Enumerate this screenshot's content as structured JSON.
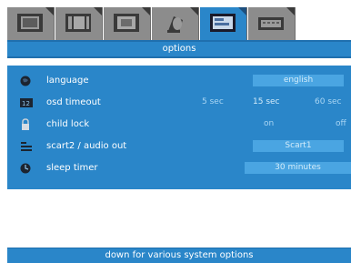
{
  "tabs": [
    {
      "icon": "tv-screen-icon",
      "active": false
    },
    {
      "icon": "picture-frame-icon",
      "active": false
    },
    {
      "icon": "monitor-icon",
      "active": false
    },
    {
      "icon": "speaker-icon",
      "active": false
    },
    {
      "icon": "settings-screen-icon",
      "active": true
    },
    {
      "icon": "keyboard-input-icon",
      "active": false
    }
  ],
  "header": {
    "title": "options"
  },
  "menu": {
    "language": {
      "label": "language",
      "value": "english",
      "icon": "globe-icon"
    },
    "osd_timeout": {
      "label": "osd timeout",
      "icon": "timer-display-icon",
      "options": [
        "5 sec",
        "15 sec",
        "60 sec"
      ],
      "selected": "15 sec"
    },
    "child_lock": {
      "label": "child lock",
      "icon": "padlock-icon",
      "options": [
        "on",
        "off"
      ]
    },
    "scart2": {
      "label": "scart2 / audio out",
      "value": "Scart1",
      "icon": "connector-icon"
    },
    "sleep_timer": {
      "label": "sleep timer",
      "value": "30 minutes",
      "icon": "clock-icon"
    }
  },
  "status_bar": {
    "text": "down for various system options"
  },
  "colors": {
    "accent": "#2a86c9",
    "tab_inactive": "#8c8c8c",
    "text": "#ffffff"
  }
}
